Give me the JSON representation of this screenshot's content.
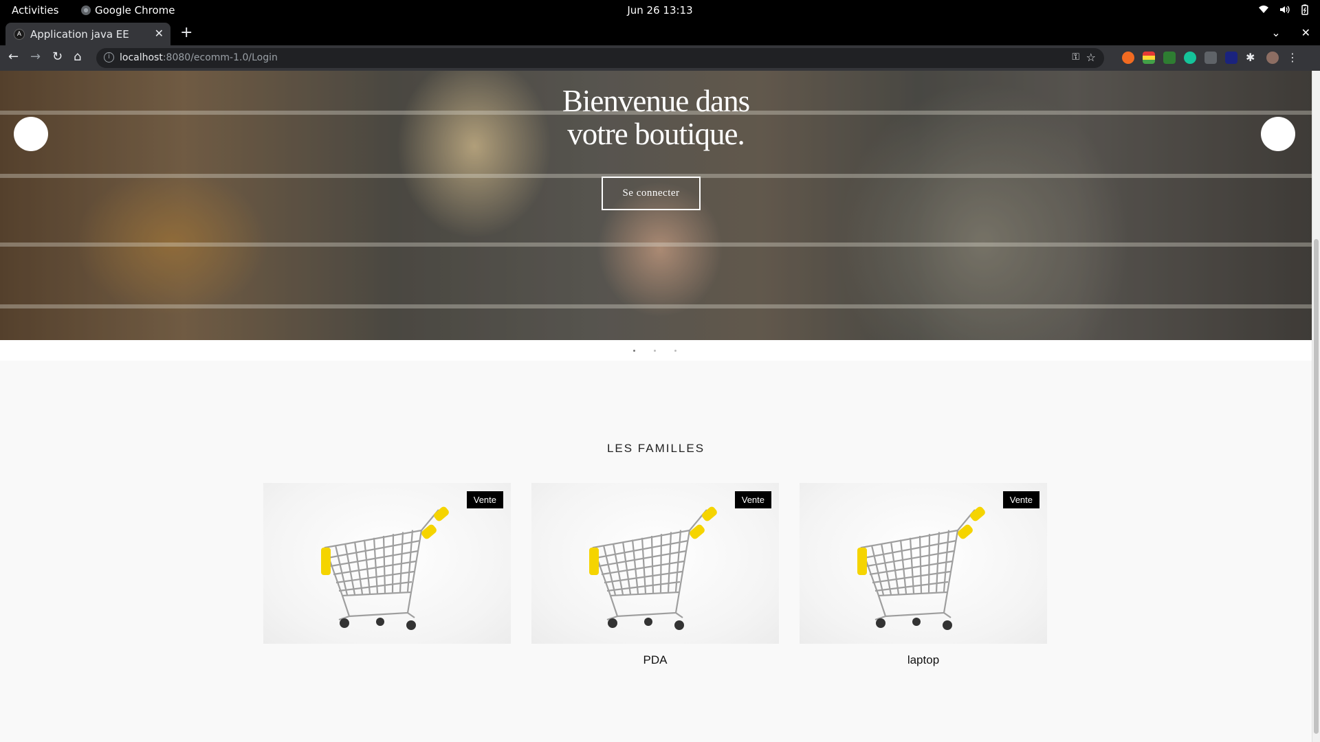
{
  "system_bar": {
    "activities": "Activities",
    "app_name": "Google Chrome",
    "clock": "Jun 26  13:13"
  },
  "browser": {
    "tab_title": "Application java EE",
    "tab_favicon_letter": "A",
    "url_host": "localhost",
    "url_path": ":8080/ecomm-1.0/Login"
  },
  "hero": {
    "title_line1": "Bienvenue dans",
    "title_line2": "votre boutique.",
    "button_label": "Se connecter",
    "slide_count": 3,
    "active_slide": 1
  },
  "families": {
    "section_title": "LES FAMILLES",
    "items": [
      {
        "name": "",
        "badge": "Vente"
      },
      {
        "name": "PDA",
        "badge": "Vente"
      },
      {
        "name": "laptop",
        "badge": "Vente"
      }
    ]
  },
  "colors": {
    "cart_handle": "#f5d400",
    "badge_bg": "#000000",
    "page_bg": "#f9f9f9"
  }
}
